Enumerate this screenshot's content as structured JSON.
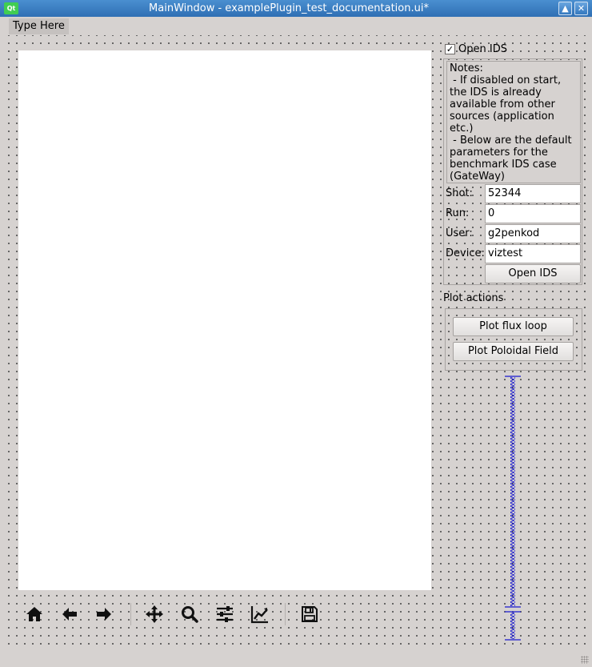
{
  "window": {
    "title": "MainWindow - examplePlugin_test_documentation.ui*",
    "app_icon_text": "Qt",
    "maximize_glyph": "▲",
    "close_glyph": "✕"
  },
  "menu": {
    "items": [
      {
        "label": "Type Here"
      }
    ]
  },
  "toolbar": {
    "tools": [
      "home-icon",
      "back-arrow-icon",
      "forward-arrow-icon",
      "pan-icon",
      "zoom-icon",
      "configure-subplots-icon",
      "edit-axis-icon",
      "save-icon"
    ]
  },
  "ids_panel": {
    "open_ids_checkbox": {
      "label": "Open IDS",
      "checked": true,
      "glyph": "✓"
    },
    "notes": [
      "Notes:",
      " - If disabled on start,",
      "the IDS is already",
      "available from other",
      "sources (application",
      "etc.)",
      " - Below are the default",
      "parameters for the",
      "benchmark IDS case",
      "(GateWay)"
    ],
    "shot": {
      "label": "Shot:",
      "value": "52344"
    },
    "run": {
      "label": "Run:",
      "value": "0"
    },
    "user": {
      "label": "User:",
      "value": "g2penkod"
    },
    "device": {
      "label": "Device:",
      "value": "viztest"
    },
    "open_button": "Open IDS"
  },
  "plot_actions": {
    "title": "Plot actions",
    "buttons": [
      "Plot flux loop",
      "Plot Poloidal Field"
    ]
  },
  "colors": {
    "titlebar": "#3a7cc4",
    "background": "#d6d2d0",
    "spacer": "#1a1ad0"
  }
}
